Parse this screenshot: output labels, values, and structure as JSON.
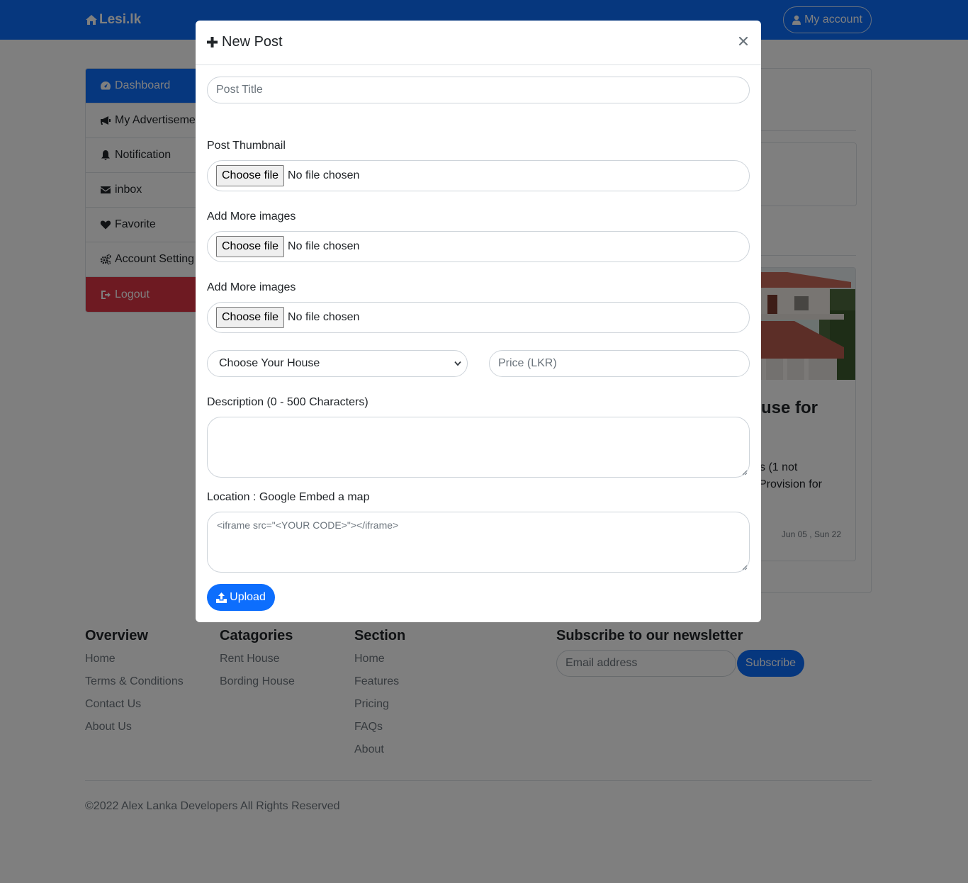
{
  "navbar": {
    "brand": "Lesi.lk",
    "account_label": "My account"
  },
  "sidebar": {
    "items": [
      {
        "label": "Dashboard",
        "icon": "dashboard-icon"
      },
      {
        "label": "My Advertiseme",
        "icon": "bullhorn-icon"
      },
      {
        "label": "Notification",
        "icon": "bell-icon"
      },
      {
        "label": "inbox",
        "icon": "envelope-icon"
      },
      {
        "label": "Favorite",
        "icon": "heart-icon"
      },
      {
        "label": "Account Setting",
        "icon": "gears-icon"
      },
      {
        "label": "Logout",
        "icon": "sign-out-icon"
      }
    ]
  },
  "main": {
    "card": {
      "title": "use for",
      "text_line1": "s (1 not",
      "text_line2": "Provision for",
      "date": "Jun 05 , Sun 22"
    }
  },
  "modal": {
    "title": "New Post",
    "post_title_placeholder": "Post Title",
    "thumbnail_label": "Post Thumbnail",
    "more_images_label_1": "Add More images",
    "more_images_label_2": "Add More images",
    "file_button": "Choose file",
    "file_status": "No file chosen",
    "house_select": "Choose Your House",
    "price_placeholder": "Price (LKR)",
    "description_label": "Description (0 - 500 Characters)",
    "location_label": "Location : Google Embed a map",
    "location_placeholder": "<iframe src=\"<YOUR CODE>\"></iframe>",
    "upload_button": "Upload"
  },
  "footer": {
    "overview": {
      "heading": "Overview",
      "links": [
        "Home",
        "Terms & Conditions",
        "Contact Us",
        "About Us"
      ]
    },
    "categories": {
      "heading": "Catagories",
      "links": [
        "Rent House",
        "Bording House"
      ]
    },
    "section": {
      "heading": "Section",
      "links": [
        "Home",
        "Features",
        "Pricing",
        "FAQs",
        "About"
      ]
    },
    "newsletter": {
      "heading": "Subscribe to our newsletter",
      "email_placeholder": "Email address",
      "subscribe_button": "Subscribe"
    },
    "copyright": "©2022 Alex Lanka Developers All Rights Reserved"
  },
  "colors": {
    "primary": "#0d6efd",
    "danger": "#dc3545",
    "backdrop": "rgba(0,0,0,0.5)"
  }
}
